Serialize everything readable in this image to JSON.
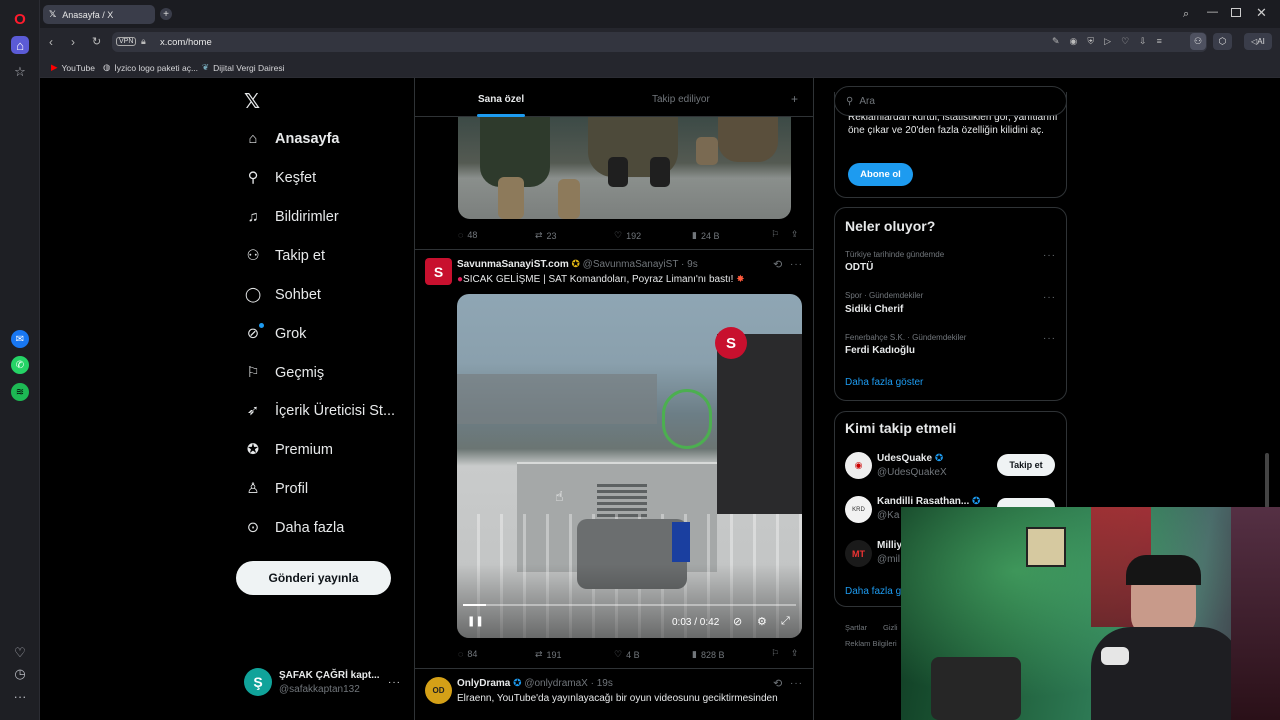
{
  "browser": {
    "tab_title": "Anasayfa / X",
    "vpn": "VPN",
    "url": "x.com/home",
    "ai_label": "AI",
    "bookmarks": [
      "YouTube",
      "İyzico logo paketi aç...",
      "Dijital Vergi Dairesi"
    ]
  },
  "nav": {
    "items": [
      "Anasayfa",
      "Keşfet",
      "Bildirimler",
      "Takip et",
      "Sohbet",
      "Grok",
      "Geçmiş",
      "İçerik Üreticisi St...",
      "Premium",
      "Profil",
      "Daha fazla"
    ],
    "post_button": "Gönderi yayınla",
    "account_name": "ŞAFAK ÇAĞRİ kapt...",
    "account_handle": "@safakkaptan132"
  },
  "feed": {
    "tab_for_you": "Sana özel",
    "tab_following": "Takip ediliyor",
    "post0_stats": {
      "replies": "48",
      "reposts": "23",
      "likes": "192",
      "views": "24 B"
    },
    "post1": {
      "name": "SavunmaSanayiST.com",
      "handle": "@SavunmaSanayiST",
      "time": "· 9s",
      "text": "SICAK GELİŞME | SAT Komandoları, Poyraz Limanı'nı bastı!",
      "video_time": "0:03 / 0:42",
      "video_progress": 0.07,
      "replies": "84",
      "reposts": "191",
      "likes": "4 B",
      "views": "828 B"
    },
    "post2": {
      "name": "OnlyDrama",
      "handle": "@onlydramaX",
      "time": "· 19s",
      "text": "Elraenn, YouTube'da yayınlayacağı bir oyun videosunu geciktirmesinden"
    }
  },
  "right": {
    "search_placeholder": "Ara",
    "premium_text": "Reklamlardan kurtul, istatistikleri gör, yanıtlarını öne çıkar ve 20'den fazla özelliğin kilidini aç.",
    "subscribe": "Abone ol",
    "trends_title": "Neler oluyor?",
    "trends": [
      {
        "meta": "Türkiye tarihinde gündemde",
        "name": "ODTÜ"
      },
      {
        "meta": "Spor · Gündemdekiler",
        "name": "Sidiki Cherif"
      },
      {
        "meta": "Fenerbahçe S.K. · Gündemdekiler",
        "name": "Ferdi Kadıoğlu"
      }
    ],
    "show_more": "Daha fazla göster",
    "who_title": "Kimi takip etmeli",
    "who": [
      {
        "name": "UdesQuake",
        "handle": "@UdesQuakeX",
        "btn": "Takip et"
      },
      {
        "name": "Kandilli Rasathan...",
        "handle": "@Ka"
      },
      {
        "name": "Milliy",
        "handle": "@mil"
      }
    ],
    "who_more": "Daha fazla g",
    "footer": [
      "Şartlar",
      "Gizli",
      "Reklam Bilgileri"
    ]
  }
}
